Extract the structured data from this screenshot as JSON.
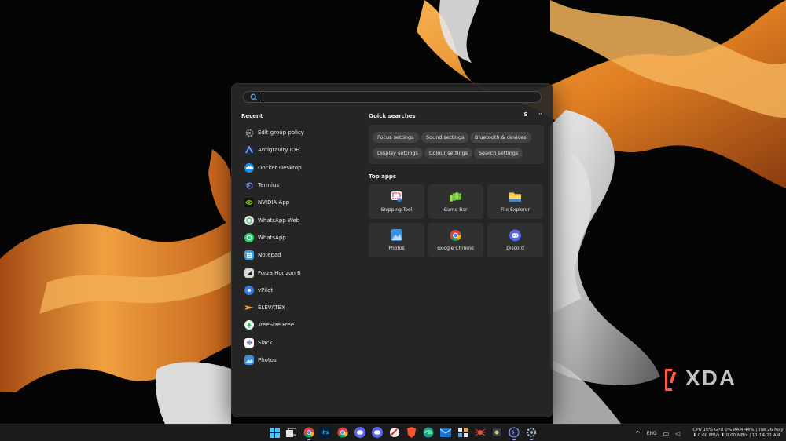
{
  "search": {
    "placeholder": ""
  },
  "recent": {
    "title": "Recent",
    "items": [
      {
        "label": "Edit group policy",
        "icon": "gear-icon",
        "color": "#9aa0a6"
      },
      {
        "label": "Antigravity IDE",
        "icon": "antigravity-icon",
        "color": "#1e2a4a"
      },
      {
        "label": "Docker Desktop",
        "icon": "docker-icon",
        "color": "#1d91e6"
      },
      {
        "label": "Termius",
        "icon": "termius-icon",
        "color": "#20243a"
      },
      {
        "label": "NVIDIA App",
        "icon": "nvidia-icon",
        "color": "#76b900"
      },
      {
        "label": "WhatsApp Web",
        "icon": "whatsapp-web-icon",
        "color": "#e8e8e8"
      },
      {
        "label": "WhatsApp",
        "icon": "whatsapp-icon",
        "color": "#25d366"
      },
      {
        "label": "Notepad",
        "icon": "notepad-icon",
        "color": "#3aa0d8"
      },
      {
        "label": "Forza Horizon 6",
        "icon": "forza-icon",
        "color": "#d8d8d8"
      },
      {
        "label": "vPilot",
        "icon": "vpilot-icon",
        "color": "#3b7ddd"
      },
      {
        "label": "ELEVATEX",
        "icon": "elevatex-icon",
        "color": "#f2a93b"
      },
      {
        "label": "TreeSize Free",
        "icon": "treesize-icon",
        "color": "#2fb34a"
      },
      {
        "label": "Slack",
        "icon": "slack-icon",
        "color": "#ffffff"
      },
      {
        "label": "Photos",
        "icon": "photos-icon",
        "color": "#3b8fe0"
      }
    ]
  },
  "quick_searches": {
    "title": "Quick searches",
    "avatar": "S",
    "more": "···",
    "chips": [
      "Focus settings",
      "Sound settings",
      "Bluetooth & devices",
      "Display settings",
      "Colour settings",
      "Search settings"
    ]
  },
  "top_apps": {
    "title": "Top apps",
    "tiles": [
      {
        "label": "Snipping Tool",
        "icon": "snipping-tool-icon"
      },
      {
        "label": "Game Bar",
        "icon": "game-bar-icon"
      },
      {
        "label": "File Explorer",
        "icon": "file-explorer-icon"
      },
      {
        "label": "Photos",
        "icon": "photos-icon"
      },
      {
        "label": "Google Chrome",
        "icon": "chrome-icon"
      },
      {
        "label": "Discord",
        "icon": "discord-icon"
      }
    ]
  },
  "taskbar": {
    "icons": [
      "windows-start-icon",
      "task-view-icon",
      "chrome-icon",
      "photoshop-icon",
      "chrome-icon",
      "discord-icon",
      "discord-icon",
      "game-icon",
      "brave-icon",
      "edge-icon",
      "mail-icon",
      "settings-app-icon",
      "spider-icon",
      "tool-icon",
      "termius-icon",
      "gear-icon"
    ],
    "photoshop_label": "Ps",
    "language": "ENG",
    "sysinfo_line1": "CPU 10% GPU   0% RAM 44% | Tue 26 May",
    "sysinfo_line2": "⬇ 0.00 MB/s ⬆ 0.00 MB/s | 11:14:21 AM"
  },
  "watermark": {
    "text": "XDA"
  },
  "colors": {
    "accent": "#8ab4f8",
    "panel": "#282828",
    "silk_orange": "#e8872e"
  }
}
